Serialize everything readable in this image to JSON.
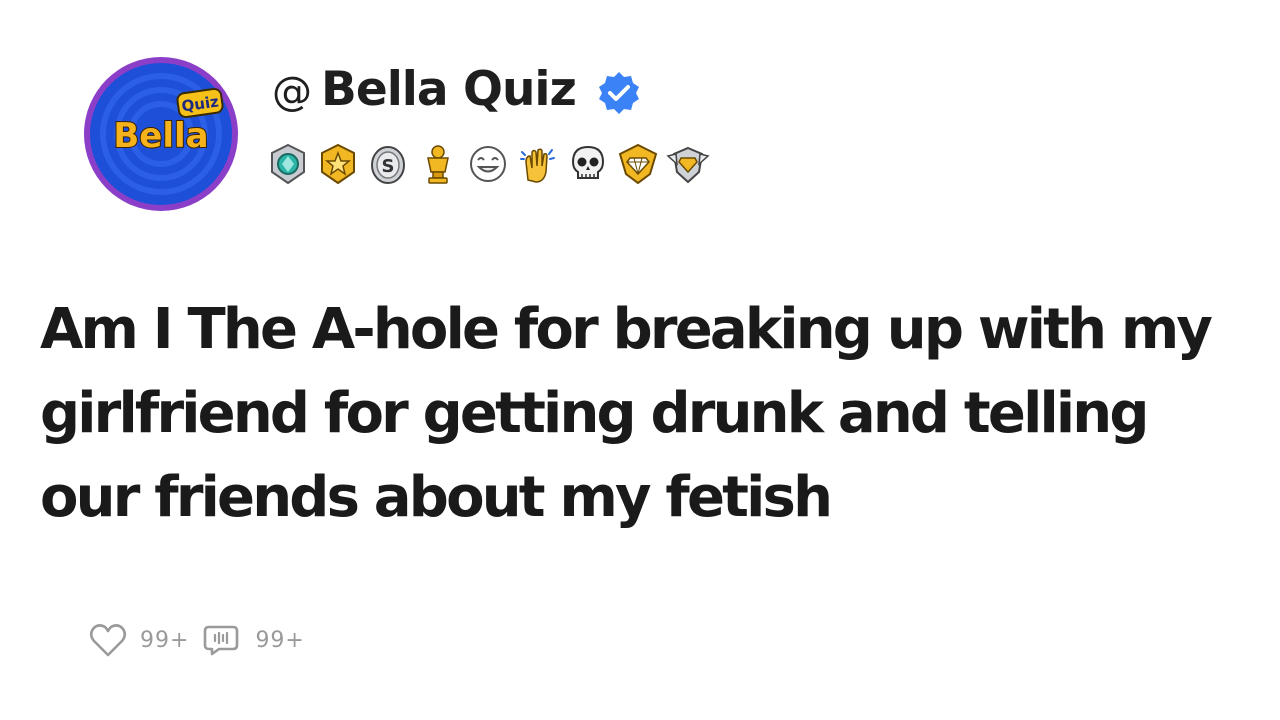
{
  "profile": {
    "at_symbol": "@",
    "name": "Bella Quiz",
    "verified_icon": "verified-check-icon",
    "verified_color": "#3b82f6",
    "avatar": {
      "text_main": "Bella",
      "text_tag": "Quiz",
      "bg_color": "#1d4fd8",
      "ring_color": "#8b3fc9",
      "text_color": "#f6b21a"
    },
    "badges": [
      "teal-gem-medal-icon",
      "gold-star-medal-icon",
      "silver-s-coin-icon",
      "gold-trophy-icon",
      "laughing-face-icon",
      "clapping-hands-icon",
      "skull-icon",
      "gold-diamond-shield-icon",
      "silver-wing-shield-icon"
    ]
  },
  "post": {
    "title": "Am I The A-hole for breaking up with my girlfriend for getting drunk and telling our friends about my fetish"
  },
  "stats": {
    "likes": "99+",
    "comments": "99+",
    "like_icon": "heart-icon",
    "comment_icon": "comment-icon"
  }
}
